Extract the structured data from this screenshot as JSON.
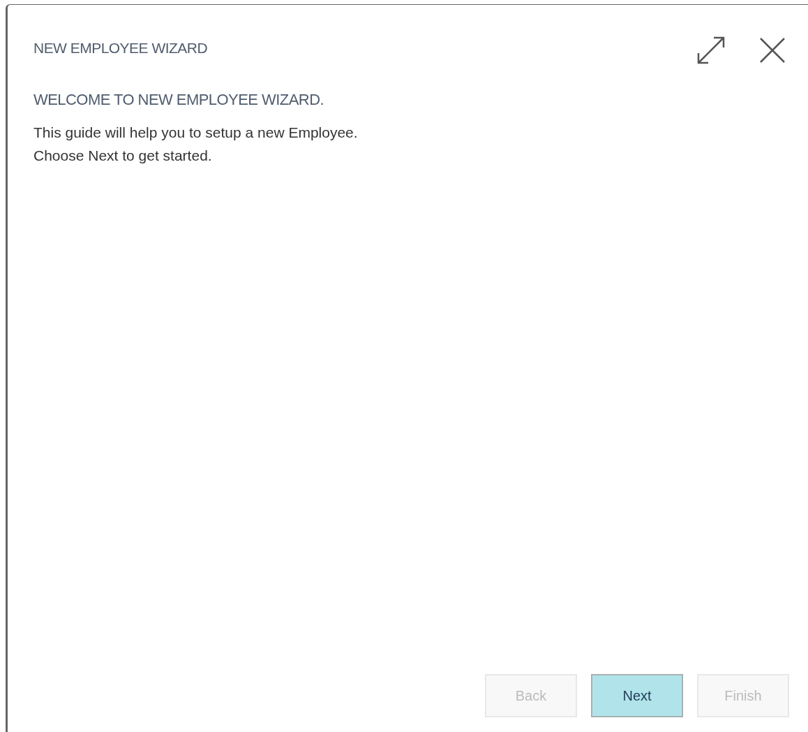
{
  "dialog": {
    "title": "NEW EMPLOYEE WIZARD"
  },
  "step": {
    "heading": "WELCOME TO NEW EMPLOYEE WIZARD.",
    "lines": [
      "This guide will help you to setup a new Employee.",
      "Choose Next to get started."
    ]
  },
  "buttons": [
    {
      "label": "Back",
      "disabled": true,
      "primary": false
    },
    {
      "label": "Next",
      "disabled": false,
      "primary": true
    },
    {
      "label": "Finish",
      "disabled": true,
      "primary": false
    }
  ]
}
